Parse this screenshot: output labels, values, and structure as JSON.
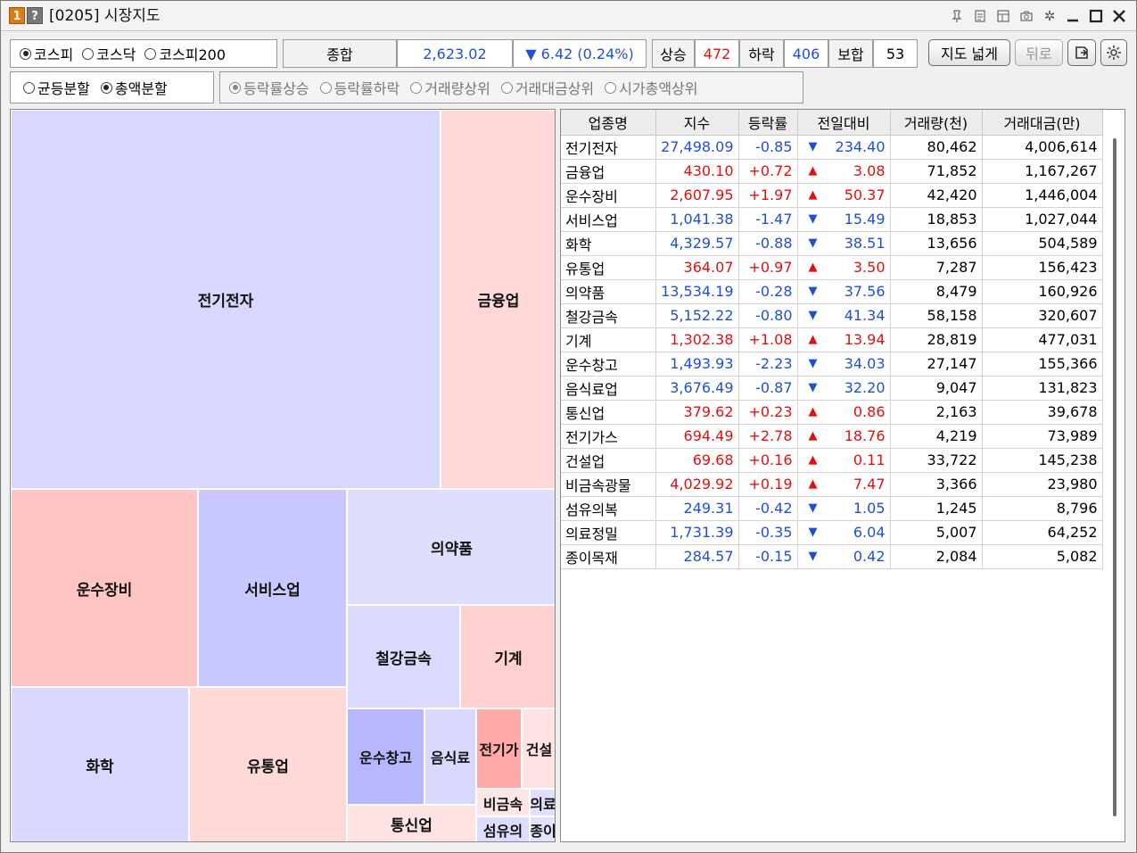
{
  "window": {
    "badge_num": "1",
    "badge_help": "?",
    "title": "[0205] 시장지도",
    "icons": [
      "pin-icon",
      "notepad-icon",
      "layout-icon",
      "camera-icon",
      "gear-icon",
      "minimize-icon",
      "maximize-icon",
      "close-icon"
    ]
  },
  "market": {
    "options": [
      "코스피",
      "코스닥",
      "코스피200"
    ],
    "selected": "코스피"
  },
  "index": {
    "label": "종합",
    "value": "2,623.02",
    "change": "▼ 6.42 (0.24%)",
    "up_label": "상승",
    "up_count": "472",
    "down_label": "하락",
    "down_count": "406",
    "flat_label": "보합",
    "flat_count": "53"
  },
  "buttons": {
    "expand_map": "지도 넓게",
    "back": "뒤로"
  },
  "split": {
    "options": [
      "균등분할",
      "총액분할"
    ],
    "selected": "총액분할"
  },
  "sort": {
    "options": [
      "등락률상승",
      "등락률하락",
      "거래량상위",
      "거래대금상위",
      "시가총액상위"
    ],
    "selected": "등락률상승"
  },
  "treemap": {
    "tiles": [
      {
        "label": "전기전자",
        "color": "#d7d7ff"
      },
      {
        "label": "금융업",
        "color": "#ffd7d7"
      },
      {
        "label": "운수장비",
        "color": "#ffc4c4"
      },
      {
        "label": "서비스업",
        "color": "#c9c9ff"
      },
      {
        "label": "의약품",
        "color": "#dedeff"
      },
      {
        "label": "철강금속",
        "color": "#dadaff"
      },
      {
        "label": "기계",
        "color": "#ffd0d0"
      },
      {
        "label": "화학",
        "color": "#d9d9ff"
      },
      {
        "label": "유통업",
        "color": "#ffd8d8"
      },
      {
        "label": "운수창고",
        "color": "#b7b7ff"
      },
      {
        "label": "음식료",
        "color": "#d9d9ff"
      },
      {
        "label": "전기가",
        "color": "#ffaaaa"
      },
      {
        "label": "건설",
        "color": "#ffe2e2"
      },
      {
        "label": "통신업",
        "color": "#ffe2e2"
      },
      {
        "label": "비금속",
        "color": "#ffe6e6"
      },
      {
        "label": "의료",
        "color": "#dfdfff"
      },
      {
        "label": "섬유의",
        "color": "#dcdcff"
      },
      {
        "label": "종이",
        "color": "#e2e2ff"
      }
    ]
  },
  "table": {
    "headers": [
      "업종명",
      "지수",
      "등락률",
      "전일대비",
      "거래량(천)",
      "거래대금(만)"
    ],
    "rows": [
      {
        "name": "전기전자",
        "index": "27,498.09",
        "rate": "-0.85",
        "dir": "▼",
        "change": "234.40",
        "volume": "80,462",
        "amount": "4,006,614",
        "color": "#1f4fd6"
      },
      {
        "name": "금융업",
        "index": "430.10",
        "rate": "+0.72",
        "dir": "▲",
        "change": "3.08",
        "volume": "71,852",
        "amount": "1,167,267",
        "color": "#e01010"
      },
      {
        "name": "운수장비",
        "index": "2,607.95",
        "rate": "+1.97",
        "dir": "▲",
        "change": "50.37",
        "volume": "42,420",
        "amount": "1,446,004",
        "color": "#e01010"
      },
      {
        "name": "서비스업",
        "index": "1,041.38",
        "rate": "-1.47",
        "dir": "▼",
        "change": "15.49",
        "volume": "18,853",
        "amount": "1,027,044",
        "color": "#1f4fd6"
      },
      {
        "name": "화학",
        "index": "4,329.57",
        "rate": "-0.88",
        "dir": "▼",
        "change": "38.51",
        "volume": "13,656",
        "amount": "504,589",
        "color": "#1f4fd6"
      },
      {
        "name": "유통업",
        "index": "364.07",
        "rate": "+0.97",
        "dir": "▲",
        "change": "3.50",
        "volume": "7,287",
        "amount": "156,423",
        "color": "#e01010"
      },
      {
        "name": "의약품",
        "index": "13,534.19",
        "rate": "-0.28",
        "dir": "▼",
        "change": "37.56",
        "volume": "8,479",
        "amount": "160,926",
        "color": "#1f4fd6"
      },
      {
        "name": "철강금속",
        "index": "5,152.22",
        "rate": "-0.80",
        "dir": "▼",
        "change": "41.34",
        "volume": "58,158",
        "amount": "320,607",
        "color": "#1f4fd6"
      },
      {
        "name": "기계",
        "index": "1,302.38",
        "rate": "+1.08",
        "dir": "▲",
        "change": "13.94",
        "volume": "28,819",
        "amount": "477,031",
        "color": "#e01010"
      },
      {
        "name": "운수창고",
        "index": "1,493.93",
        "rate": "-2.23",
        "dir": "▼",
        "change": "34.03",
        "volume": "27,147",
        "amount": "155,366",
        "color": "#1f4fd6"
      },
      {
        "name": "음식료업",
        "index": "3,676.49",
        "rate": "-0.87",
        "dir": "▼",
        "change": "32.20",
        "volume": "9,047",
        "amount": "131,823",
        "color": "#1f4fd6"
      },
      {
        "name": "통신업",
        "index": "379.62",
        "rate": "+0.23",
        "dir": "▲",
        "change": "0.86",
        "volume": "2,163",
        "amount": "39,678",
        "color": "#e01010"
      },
      {
        "name": "전기가스",
        "index": "694.49",
        "rate": "+2.78",
        "dir": "▲",
        "change": "18.76",
        "volume": "4,219",
        "amount": "73,989",
        "color": "#e01010"
      },
      {
        "name": "건설업",
        "index": "69.68",
        "rate": "+0.16",
        "dir": "▲",
        "change": "0.11",
        "volume": "33,722",
        "amount": "145,238",
        "color": "#e01010"
      },
      {
        "name": "비금속광물",
        "index": "4,029.92",
        "rate": "+0.19",
        "dir": "▲",
        "change": "7.47",
        "volume": "3,366",
        "amount": "23,980",
        "color": "#e01010"
      },
      {
        "name": "섬유의복",
        "index": "249.31",
        "rate": "-0.42",
        "dir": "▼",
        "change": "1.05",
        "volume": "1,245",
        "amount": "8,796",
        "color": "#1f4fd6"
      },
      {
        "name": "의료정밀",
        "index": "1,731.39",
        "rate": "-0.35",
        "dir": "▼",
        "change": "6.04",
        "volume": "5,007",
        "amount": "64,252",
        "color": "#1f4fd6"
      },
      {
        "name": "종이목재",
        "index": "284.57",
        "rate": "-0.15",
        "dir": "▼",
        "change": "0.42",
        "volume": "2,084",
        "amount": "5,082",
        "color": "#1f4fd6"
      }
    ]
  }
}
